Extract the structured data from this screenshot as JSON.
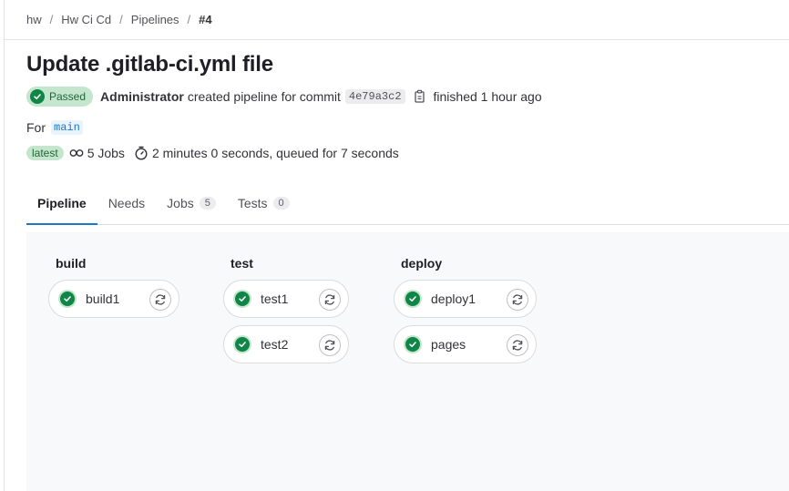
{
  "breadcrumb": {
    "items": [
      "hw",
      "Hw Ci Cd",
      "Pipelines"
    ],
    "current": "#4",
    "separator": "/"
  },
  "page_title": "Update .gitlab-ci.yml file",
  "status": {
    "label": "Passed",
    "icon": "check-circle-icon",
    "color": "#108548"
  },
  "meta": {
    "author": "Administrator",
    "action": "created pipeline for commit",
    "commit_sha": "4e79a3c2",
    "finished": "finished 1 hour ago"
  },
  "ref": {
    "prefix": "For",
    "branch": "main"
  },
  "stats": {
    "badge": "latest",
    "jobs": "5 Jobs",
    "duration": "2 minutes 0 seconds, queued for 7 seconds"
  },
  "tabs": [
    {
      "label": "Pipeline",
      "active": true
    },
    {
      "label": "Needs"
    },
    {
      "label": "Jobs",
      "count": "5"
    },
    {
      "label": "Tests",
      "count": "0"
    }
  ],
  "stages": [
    {
      "title": "build",
      "jobs": [
        {
          "name": "build1",
          "status": "success"
        }
      ]
    },
    {
      "title": "test",
      "jobs": [
        {
          "name": "test1",
          "status": "success"
        },
        {
          "name": "test2",
          "status": "success"
        }
      ]
    },
    {
      "title": "deploy",
      "jobs": [
        {
          "name": "deploy1",
          "status": "success"
        },
        {
          "name": "pages",
          "status": "success"
        }
      ]
    }
  ],
  "colors": {
    "accent": "#1f75cb",
    "success": "#108548",
    "success_bg": "#c3e6cd"
  }
}
